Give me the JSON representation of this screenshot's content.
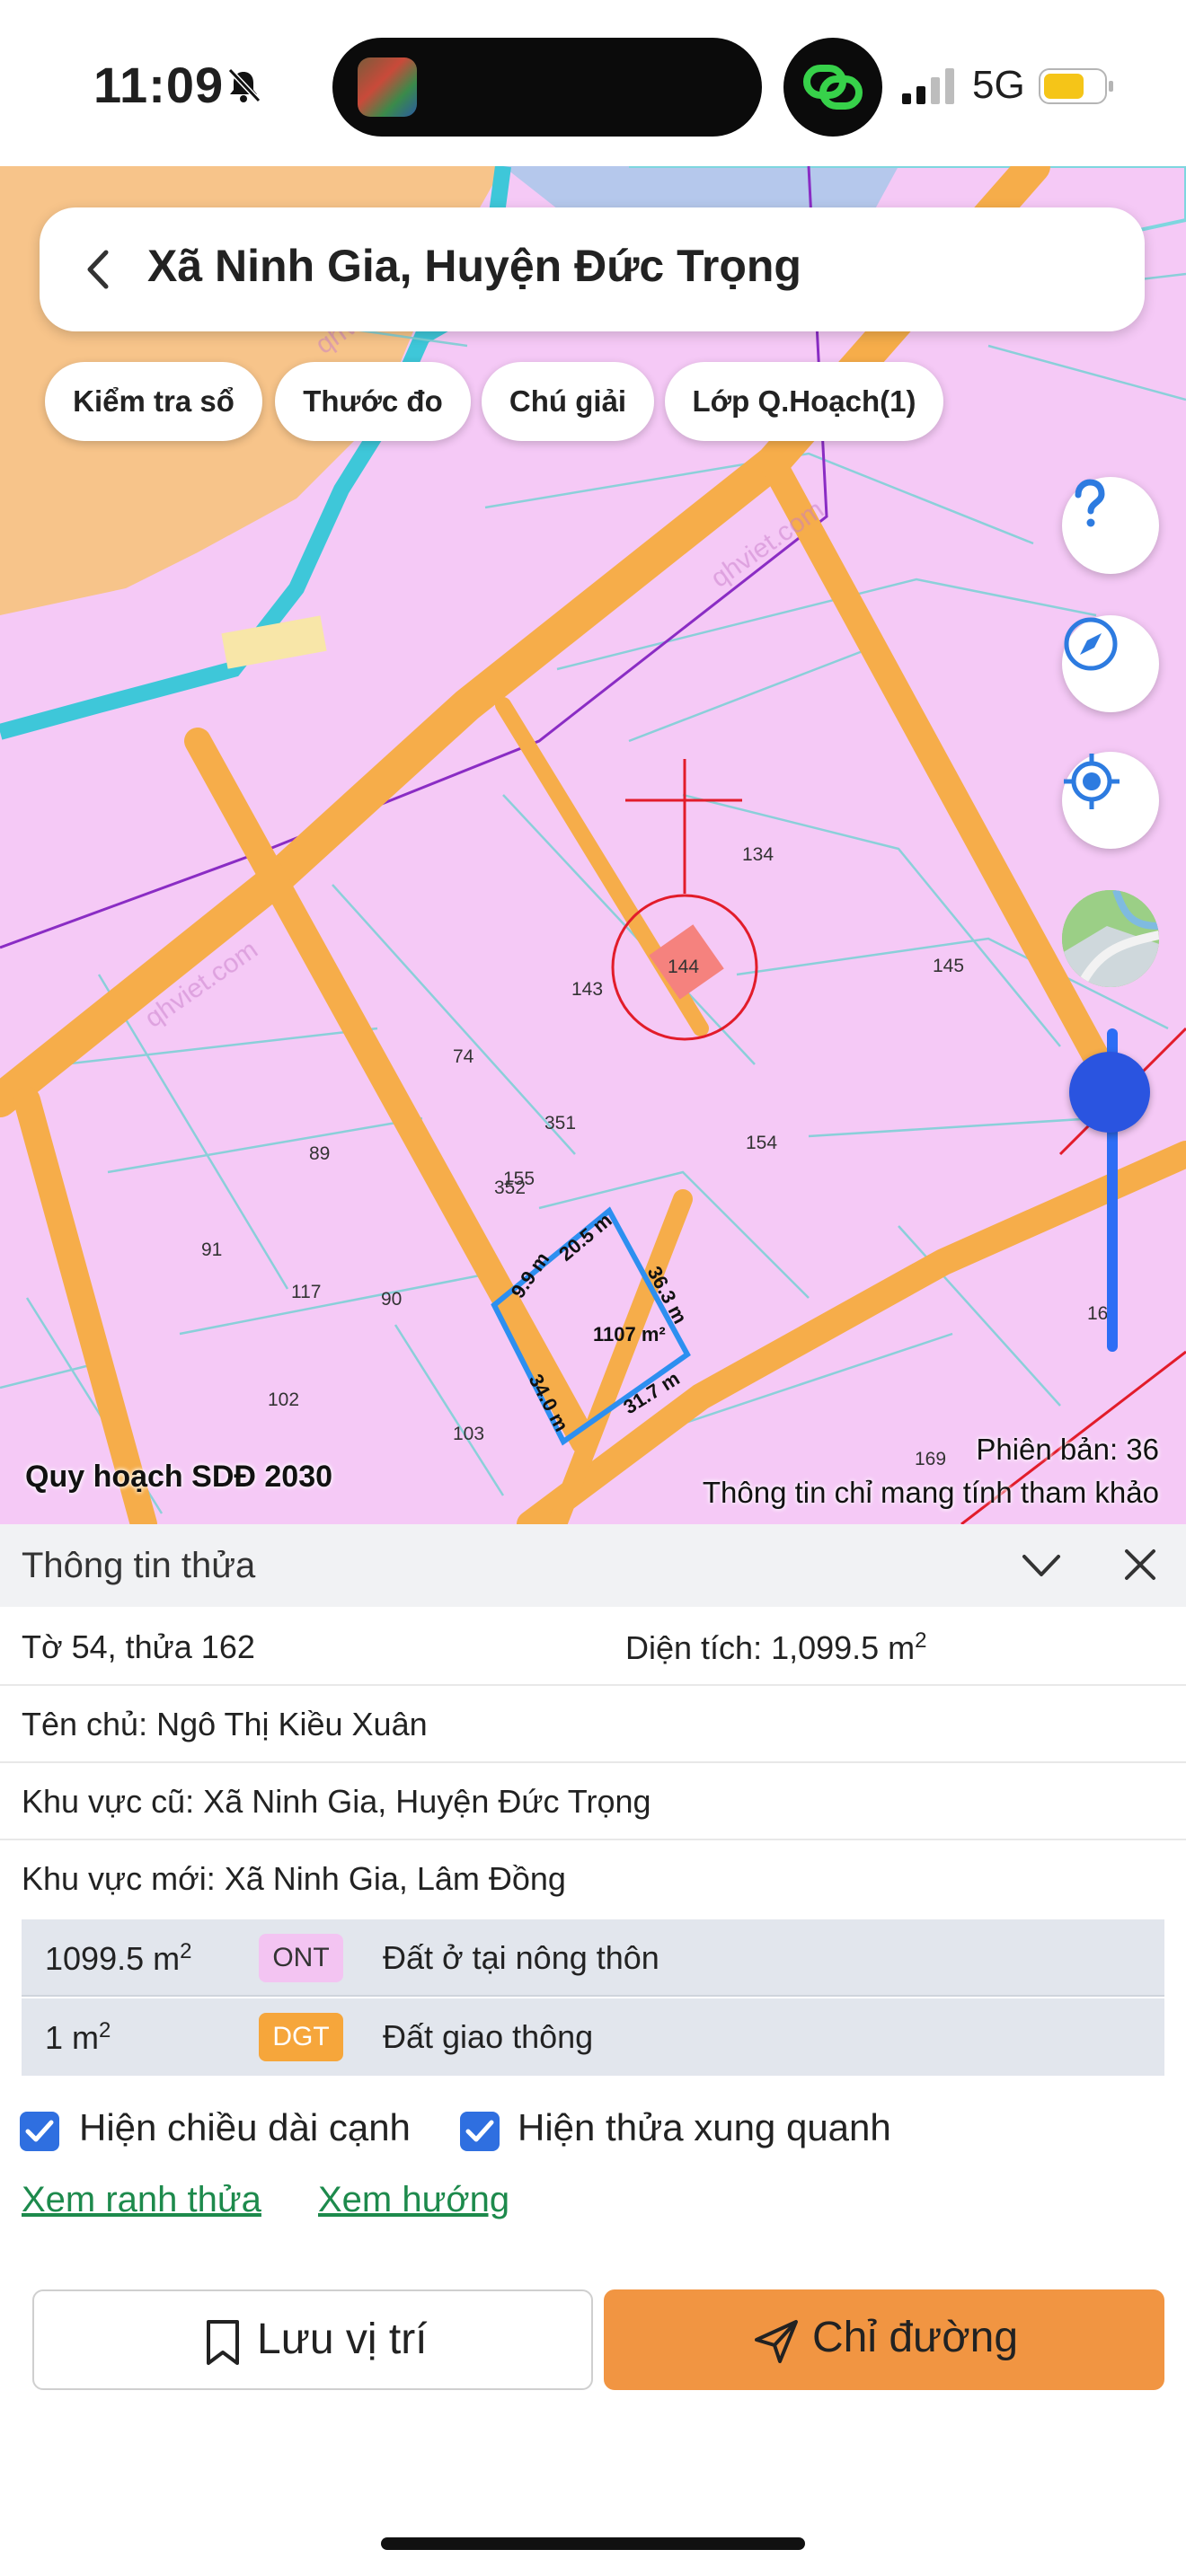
{
  "status_bar": {
    "time": "11:09",
    "network": "5G",
    "icons": [
      "bell-off-icon",
      "app-thumbnail-icon",
      "chain-link-icon",
      "signal-icon",
      "battery-icon"
    ]
  },
  "search": {
    "title": "Xã Ninh Gia, Huyện Đức Trọng"
  },
  "chips": [
    {
      "label": "Kiểm tra sổ"
    },
    {
      "label": "Thước đo"
    },
    {
      "label": "Chú giải"
    },
    {
      "label": "Lớp Q.Hoạch(1)"
    }
  ],
  "map": {
    "caption": "Quy hoạch SDĐ 2030",
    "version": "Phiên bản: 36",
    "disclaimer": "Thông tin chỉ mang tính tham khảo",
    "watermark": "qhviet.com",
    "parcel_numbers": [
      "134",
      "144",
      "143",
      "145",
      "74",
      "351",
      "154",
      "89",
      "352",
      "155",
      "91",
      "117",
      "90",
      "102",
      "103",
      "169",
      "16"
    ],
    "selected_parcel": {
      "area_label": "1107 m²",
      "edges": [
        "9.9 m",
        "20.5 m",
        "36.3 m",
        "31.7 m",
        "34.0 m"
      ]
    },
    "colors": {
      "residential": "#f5c9f6",
      "road": "#f6ad4a",
      "agri": "#f7c48a",
      "water": "#3ec7d9",
      "selection": "#2d8ff0",
      "target": "#e21c2a"
    }
  },
  "panel": {
    "title": "Thông tin thửa",
    "sheet_parcel": "Tờ 54, thửa 162",
    "area_label": "Diện tích: 1,099.5 m",
    "area_sup": "2",
    "owner": "Tên chủ: Ngô Thị Kiều Xuân",
    "old_region": "Khu vực cũ: Xã Ninh Gia, Huyện Đức Trọng",
    "new_region": "Khu vực mới: Xã Ninh Gia, Lâm Đồng",
    "land_types": [
      {
        "area": "1099.5 m",
        "sup": "2",
        "code": "ONT",
        "name": "Đất ở tại nông thôn",
        "badge_color": "#f3c4f2"
      },
      {
        "area": "1 m",
        "sup": "2",
        "code": "DGT",
        "name": "Đất giao thông",
        "badge_color": "#f6a63b"
      }
    ],
    "checkboxes": [
      {
        "label": "Hiện chiều dài cạnh",
        "checked": true
      },
      {
        "label": "Hiện thửa xung quanh",
        "checked": true
      }
    ],
    "links": [
      "Xem ranh thửa",
      "Xem hướng"
    ],
    "save_label": "Lưu vị trí",
    "directions_label": "Chỉ đường"
  }
}
